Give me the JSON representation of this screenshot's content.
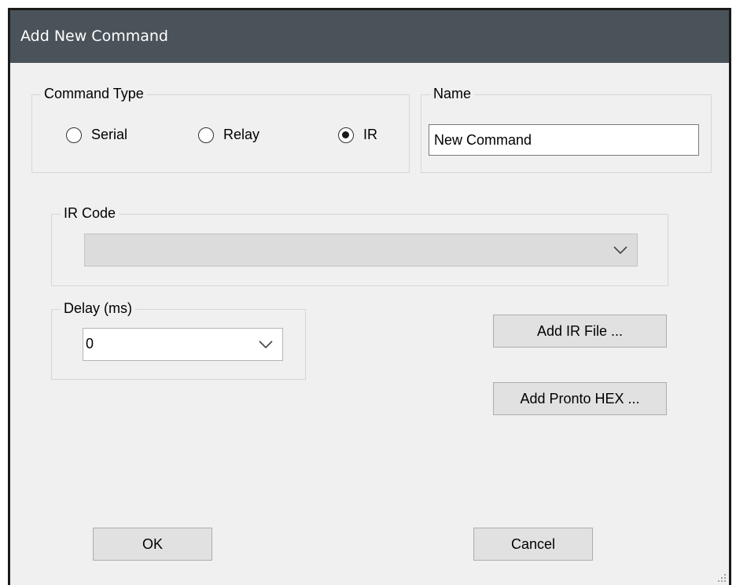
{
  "window": {
    "title": "Add New Command"
  },
  "command_type": {
    "legend": "Command Type",
    "options": [
      {
        "label": "Serial",
        "checked": false
      },
      {
        "label": "Relay",
        "checked": false
      },
      {
        "label": "IR",
        "checked": true
      }
    ]
  },
  "name": {
    "legend": "Name",
    "value": "New Command"
  },
  "ir_code": {
    "legend": "IR Code",
    "value": "",
    "enabled": false
  },
  "delay": {
    "legend": "Delay (ms)",
    "value": "0"
  },
  "buttons": {
    "add_ir_file": "Add IR File ...",
    "add_pronto_hex": "Add Pronto HEX ...",
    "ok": "OK",
    "cancel": "Cancel"
  },
  "colors": {
    "titlebar": "#4a535a",
    "dialog_background": "#f0f0f0",
    "button_face": "#e1e1e1",
    "disabled_combo": "#dcdcdc"
  },
  "icons": [
    "chevron-down-icon",
    "radio-unchecked-icon",
    "radio-checked-icon",
    "resize-grip-icon"
  ]
}
